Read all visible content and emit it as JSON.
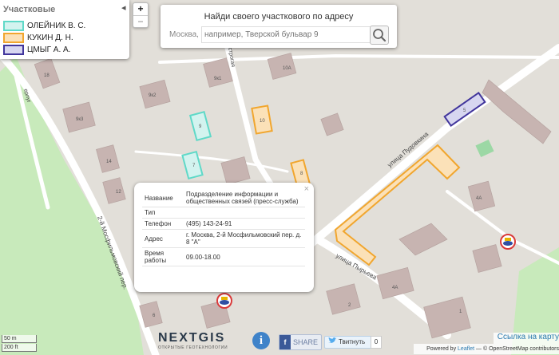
{
  "legend": {
    "title": "Участковые",
    "items": [
      {
        "label": "ОЛЕЙНИК В. С.",
        "fill": "#d3f3ef",
        "stroke": "#5fd9c8"
      },
      {
        "label": "КУКИН Д. Н.",
        "fill": "#fbe1b8",
        "stroke": "#f1a62e"
      },
      {
        "label": "ЦМЫГ А. А.",
        "fill": "#d7d6f0",
        "stroke": "#41359c"
      }
    ]
  },
  "zoom": {
    "in": "+",
    "out": "−"
  },
  "search": {
    "heading": "Найди своего участкового по адресу",
    "city": "Москва,",
    "placeholder": "например, Тверской бульвар 9"
  },
  "popup": {
    "close": "×",
    "rows": [
      {
        "key": "Название",
        "value": "Подразделение информации и общественных связей (пресс-служба)"
      },
      {
        "key": "Тип",
        "value": ""
      },
      {
        "key": "Телефон",
        "value": "(495) 143-24-91"
      },
      {
        "key": "Адрес",
        "value": "г. Москва, 2-й Мосфильмовский пер. д. 8 \"А\""
      },
      {
        "key": "Время работы",
        "value": "09.00-18.00"
      }
    ]
  },
  "map_labels": {
    "street_pudovkina": "улица Пудовкина",
    "street_pyreva": "улица Пырьева",
    "street_mosfilm": "2-й Мосфильмовский пер.",
    "street_other": "строгая"
  },
  "house_numbers": [
    "18",
    "9к1",
    "10А",
    "9к2",
    "9к3",
    "9",
    "10",
    "5",
    "14",
    "7",
    "8",
    "12",
    "4А",
    "4А",
    "2",
    "6",
    "1"
  ],
  "scale": {
    "metric": "50 m",
    "imperial": "200 ft"
  },
  "logo": {
    "text": "NEXTGIS",
    "tagline": "ОТКРЫТЫЕ ГЕОТЕХНОЛОГИИ"
  },
  "info_label": "i",
  "share_label": "SHARE",
  "tweet": {
    "label": "Твитнуть",
    "count": "0"
  },
  "map_link": "Ссылка на карту",
  "attribution": {
    "prefix": "Powered by",
    "leaflet": "Leaflet",
    "rest": "— © OpenStreetMap contributors"
  },
  "colors": {
    "olein": "#5fd9c8",
    "kukin": "#f1a62e",
    "tsmyg": "#41359c",
    "building": "#c7b4b1",
    "park": "#c8eabb"
  }
}
